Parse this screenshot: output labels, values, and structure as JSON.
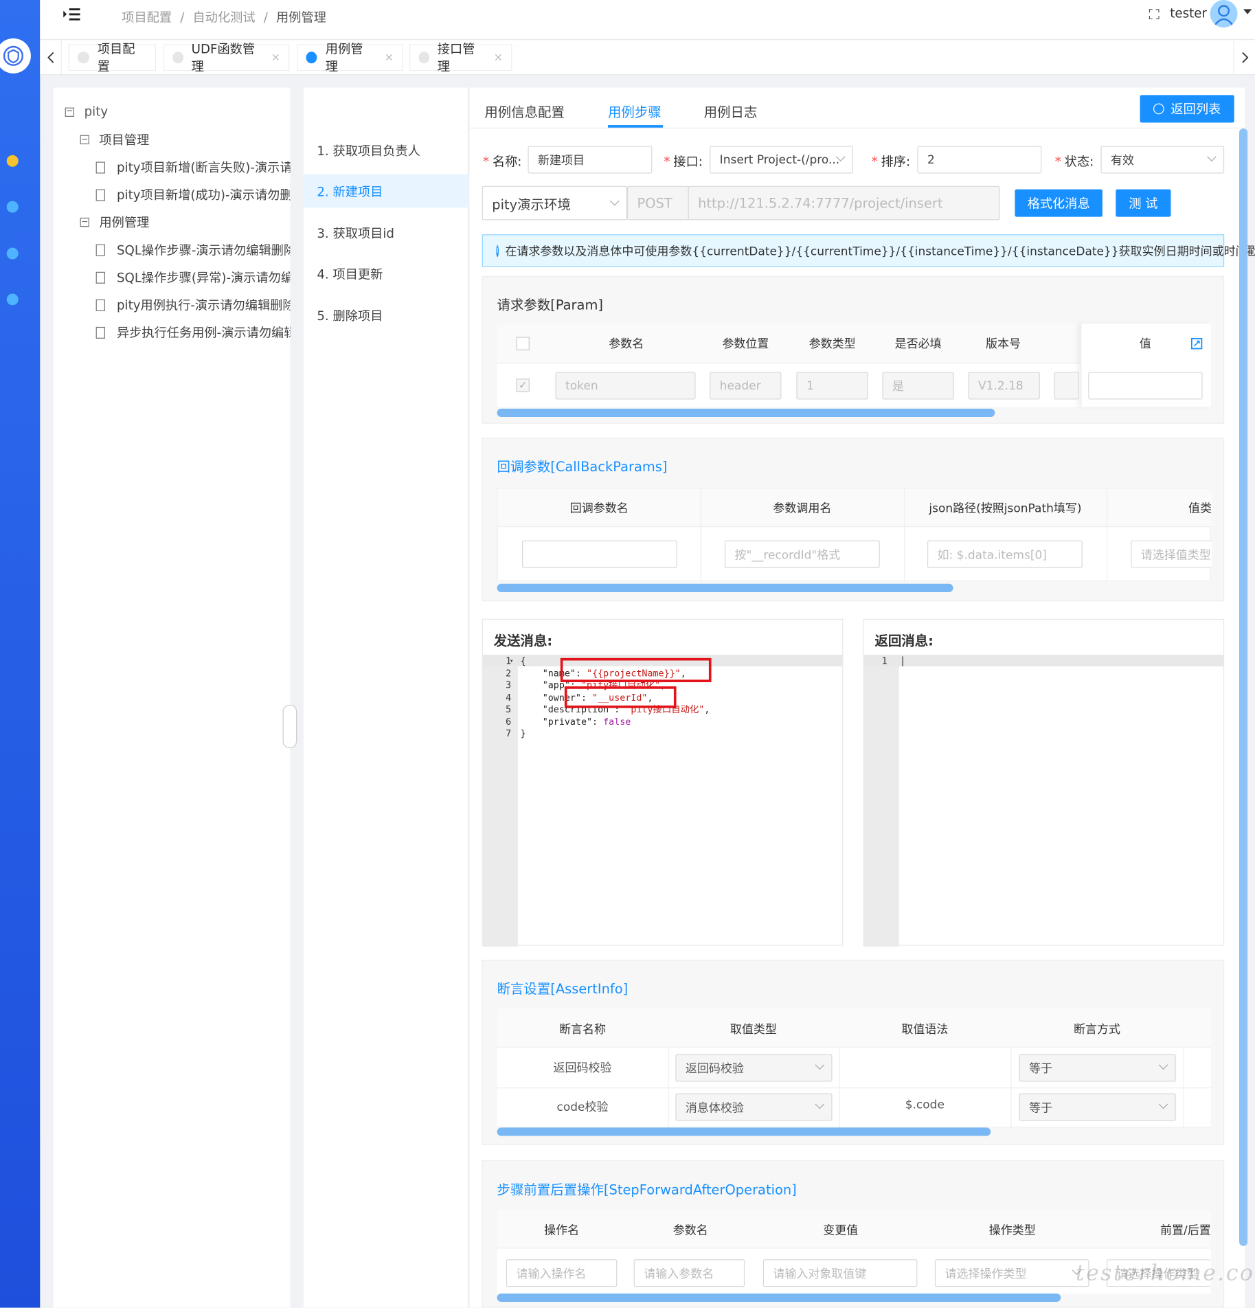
{
  "header": {
    "breadcrumb": [
      "项目配置",
      "自动化测试",
      "用例管理"
    ],
    "username": "tester",
    "separator": "/"
  },
  "tabs": [
    {
      "label": "项目配置",
      "active": false
    },
    {
      "label": "UDF函数管理",
      "active": false
    },
    {
      "label": "用例管理",
      "active": true
    },
    {
      "label": "接口管理",
      "active": false
    }
  ],
  "tab_close": "×",
  "tree": {
    "root": "pity",
    "groups": [
      {
        "label": "项目管理",
        "items": [
          "pity项目新增(断言失败)-演示请勿",
          "pity项目新增(成功)-演示请勿删除"
        ]
      },
      {
        "label": "用例管理",
        "items": [
          "SQL操作步骤-演示请勿编辑删除(",
          "SQL操作步骤(异常)-演示请勿编辑",
          "pity用例执行-演示请勿编辑删除(",
          "异步执行任务用例-演示请勿编辑"
        ]
      }
    ]
  },
  "main_tabs": [
    "用例信息配置",
    "用例步骤",
    "用例日志"
  ],
  "back_button": "返回列表",
  "steps": [
    "1. 获取项目负责人",
    "2. 新建项目",
    "3. 获取项目id",
    "4. 项目更新",
    "5. 删除项目"
  ],
  "form": {
    "name_label": "名称:",
    "name_value": "新建项目",
    "api_label": "接口:",
    "api_value": "Insert Project-(/pro...",
    "order_label": "排序:",
    "order_value": "2",
    "status_label": "状态:",
    "status_value": "有效",
    "env": "pity演示环境",
    "method": "POST",
    "url": "http://121.5.2.74:7777/project/insert",
    "format_button": "格式化消息",
    "test_button": "测 试"
  },
  "info_text": "在请求参数以及消息体中可使用参数{{currentDate}}/{{currentTime}}/{{instanceTime}}/{{instanceDate}}获取实例日期时间或时间戳。",
  "param": {
    "title": "请求参数[Param]",
    "headers": [
      "参数名",
      "参数位置",
      "参数类型",
      "是否必填",
      "版本号",
      "值"
    ],
    "row": {
      "name": "token",
      "location": "header",
      "type": "1",
      "required": "是",
      "version": "V1.2.18",
      "value": ""
    }
  },
  "callback": {
    "title": "回调参数[CallBackParams]",
    "headers": [
      "回调参数名",
      "参数调用名",
      "json路径(按照jsonPath填写)",
      "值类"
    ],
    "placeholders": [
      "",
      "按\"__recordId\"格式",
      "如: $.data.items[0]",
      "请选择值类型"
    ]
  },
  "send": {
    "title": "发送消息:",
    "lines": [
      "{",
      "    \"name\": \"{{projectName}}\",",
      "    \"app\": \"pity接口自动化\",",
      "    \"owner\": \"__userId\",",
      "    \"description\": \"pity接口自动化\",",
      "    \"private\": false",
      "}"
    ]
  },
  "recv": {
    "title": "返回消息:"
  },
  "assert": {
    "title": "断言设置[AssertInfo]",
    "headers": [
      "断言名称",
      "取值类型",
      "取值语法",
      "断言方式"
    ],
    "rows": [
      {
        "name": "返回码校验",
        "type": "返回码校验",
        "expr": "",
        "method": "等于"
      },
      {
        "name": "code校验",
        "type": "消息体校验",
        "expr": "$.code",
        "method": "等于"
      }
    ]
  },
  "ops": {
    "title": "步骤前置后置操作[StepForwardAfterOperation]",
    "headers": [
      "操作名",
      "参数名",
      "变更值",
      "操作类型",
      "前置/后置"
    ],
    "placeholders": [
      "请输入操作名",
      "请输入参数名",
      "请输入对象取值键",
      "请选择操作类型",
      "请选择操作类型"
    ]
  },
  "watermark": "testerhome.com"
}
